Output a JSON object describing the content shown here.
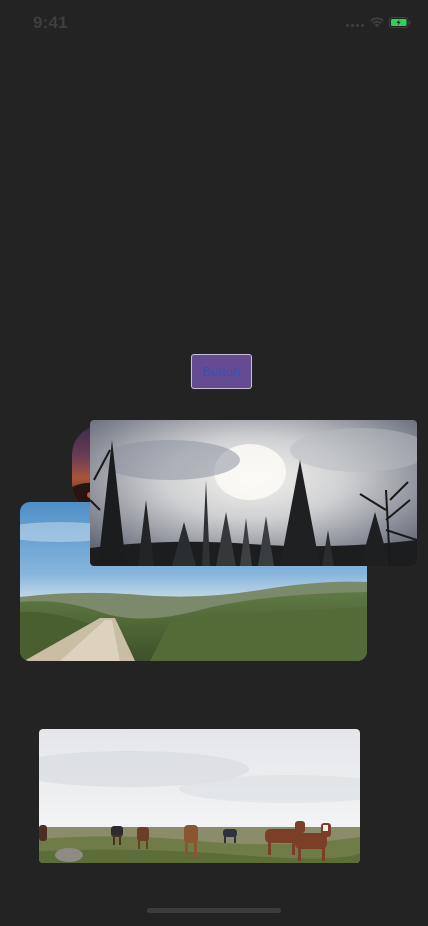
{
  "status_bar": {
    "time": "9:41",
    "icons": [
      "cellular-signal-icon",
      "wifi-icon",
      "battery-charging-icon"
    ],
    "battery_color": "#30d158"
  },
  "button": {
    "label": "Button",
    "background": "#654b91",
    "text_color": "#2f55b8"
  },
  "photos": [
    {
      "name": "sunset-photo",
      "description_icon": "sunset-image"
    },
    {
      "name": "country-road-photo",
      "description_icon": "landscape-image"
    },
    {
      "name": "misty-forest-photo",
      "description_icon": "forest-image"
    },
    {
      "name": "wild-horses-photo",
      "description_icon": "horses-image"
    }
  ],
  "colors": {
    "background": "#232323"
  }
}
